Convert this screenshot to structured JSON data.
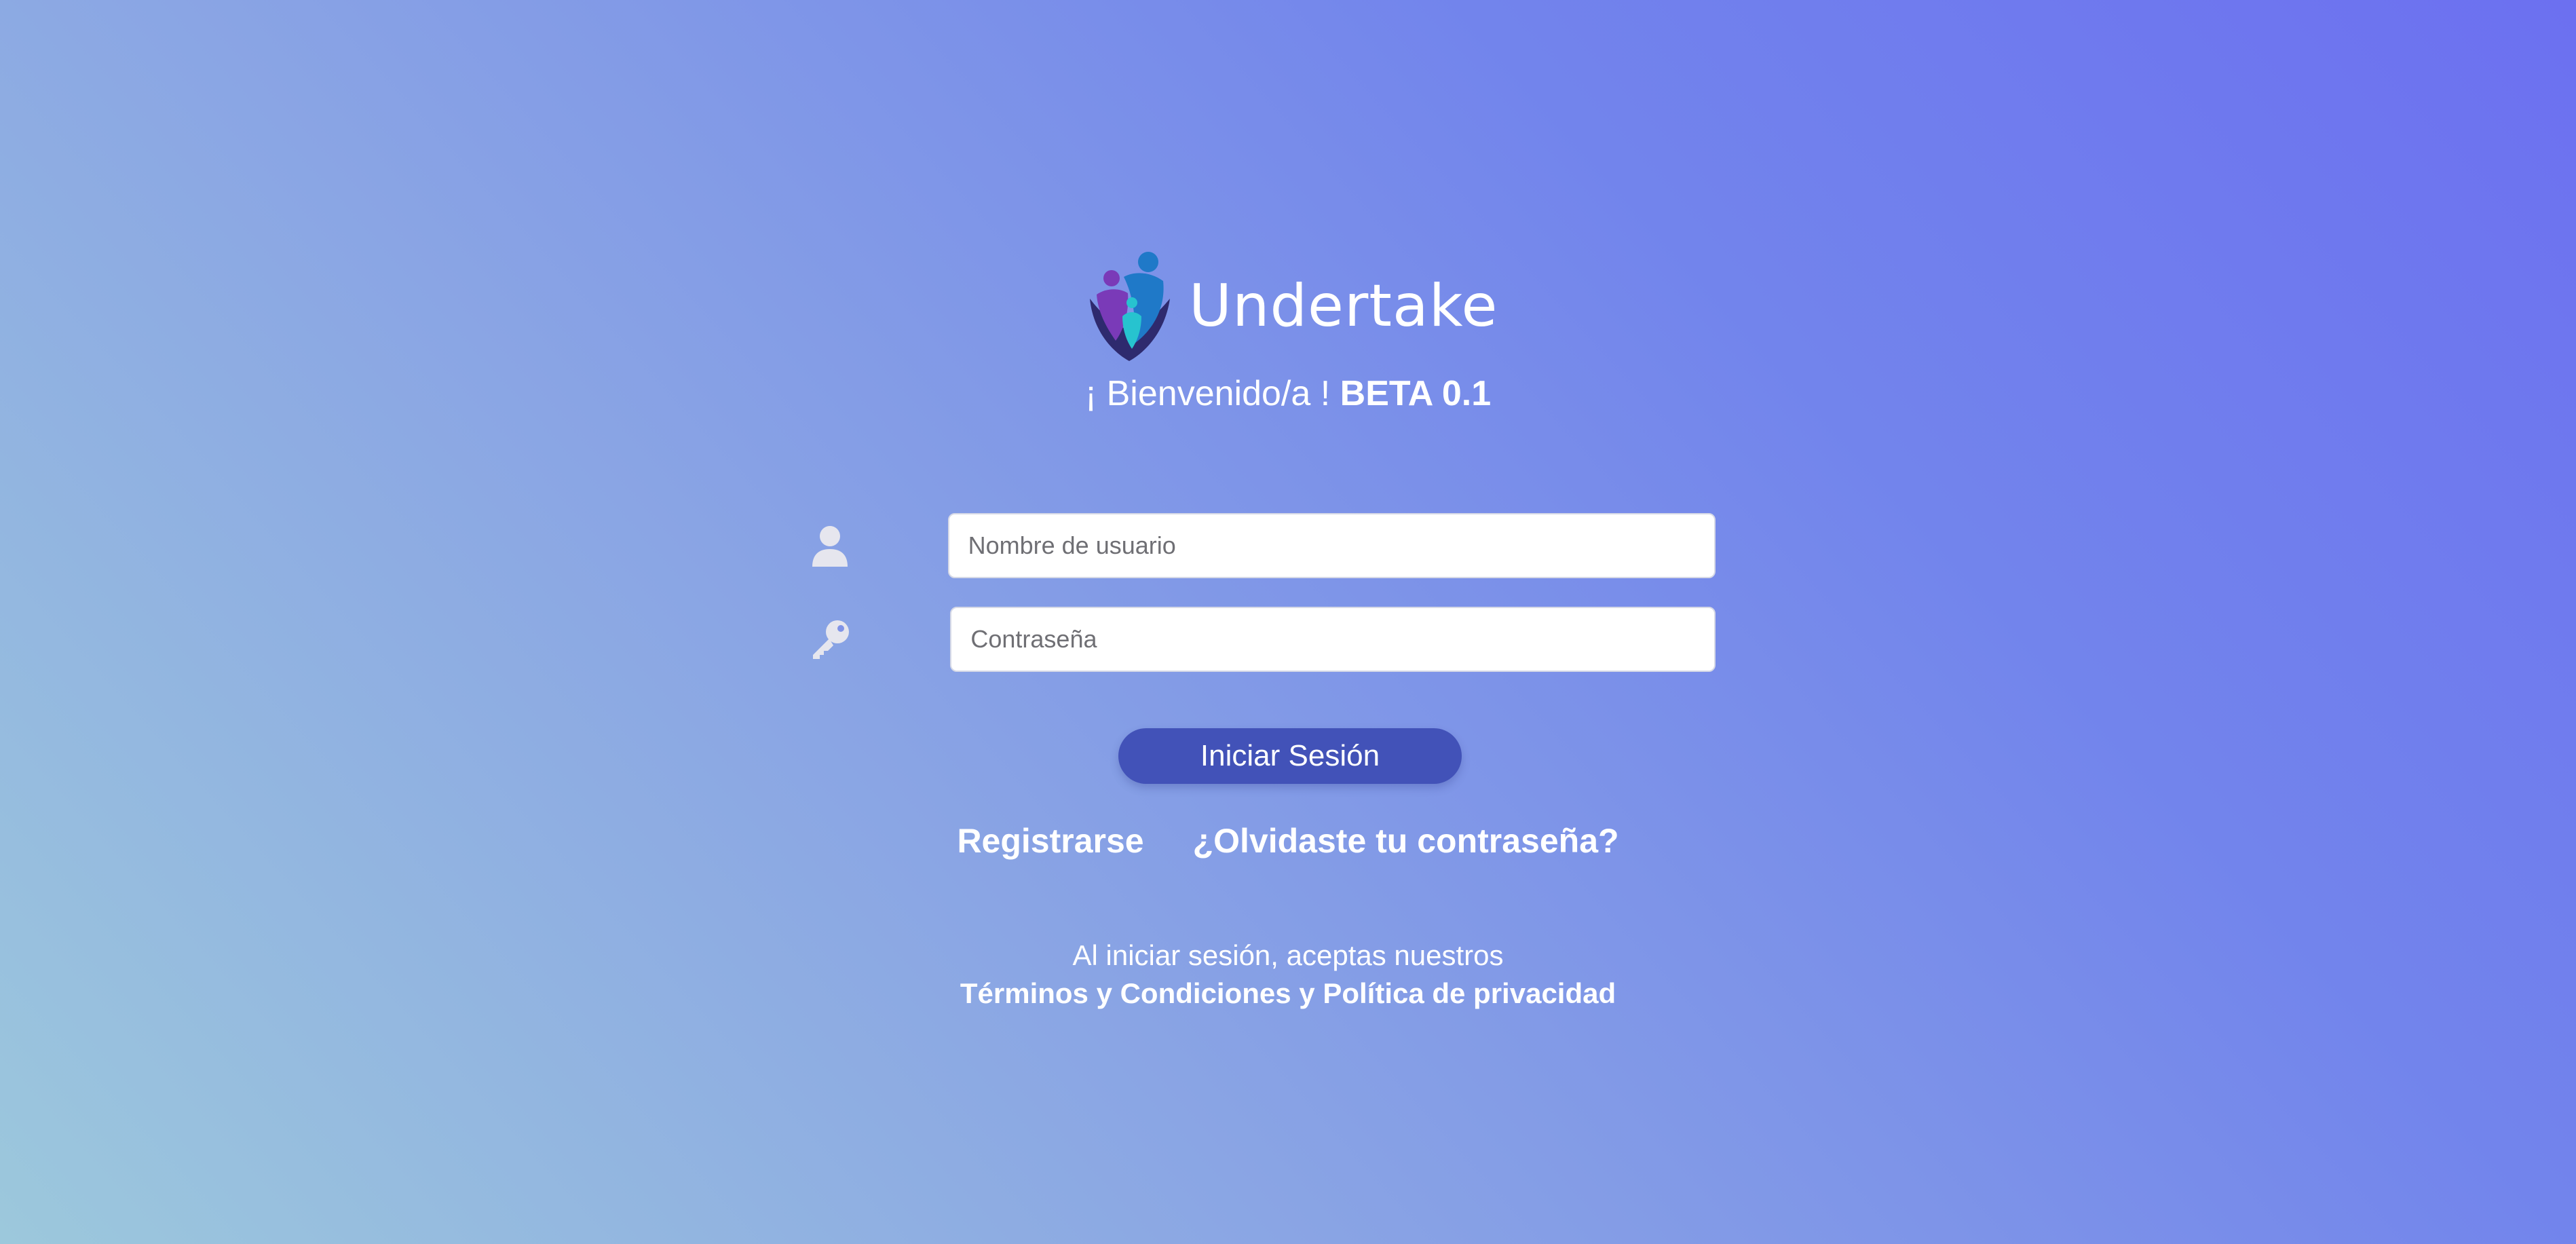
{
  "brand": {
    "name": "Undertake",
    "logo_icon": "shield-family-logo"
  },
  "welcome": {
    "prefix": "¡ Bienvenido/a ! ",
    "version": "BETA 0.1"
  },
  "form": {
    "username": {
      "icon": "user-icon",
      "placeholder": "Nombre de usuario",
      "value": ""
    },
    "password": {
      "icon": "key-icon",
      "placeholder": "Contraseña",
      "value": ""
    },
    "login_label": "Iniciar Sesión"
  },
  "links": {
    "register": "Registrarse",
    "forgot_password": "¿Olvidaste tu contraseña?"
  },
  "terms": {
    "intro": "Al iniciar sesión, aceptas nuestros",
    "terms_link": "Términos y Condiciones",
    "conjunction": " y ",
    "privacy_link": "Política de privacidad"
  },
  "colors": {
    "background_top_right": "#6c70f0",
    "background_bottom_left": "#9cc8dc",
    "button": "#4252b8",
    "text": "#ffffff",
    "icon": "#e6e6ee"
  }
}
